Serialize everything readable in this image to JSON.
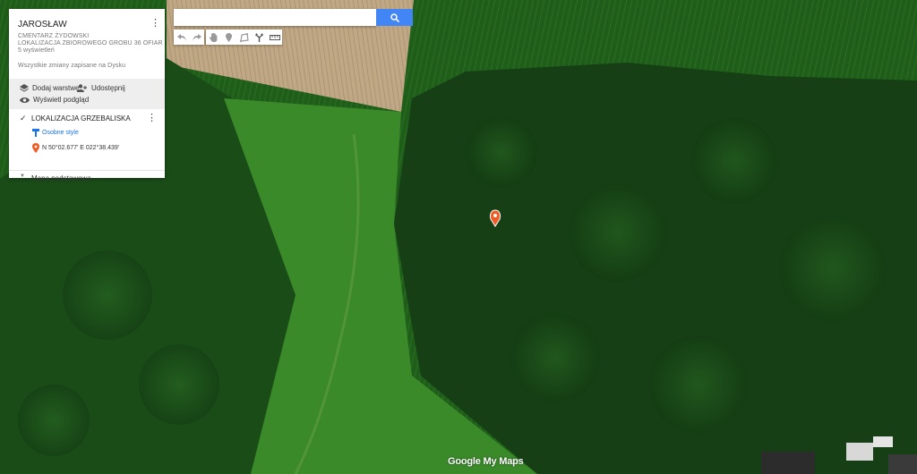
{
  "map": {
    "colors": {
      "field": "#1c5a17",
      "harvested": "#b39a78",
      "meadow": "#3f8a2c",
      "forest": "#153d14"
    },
    "marker_color": "#f05a24"
  },
  "sidebar": {
    "title": "JAROSŁAW",
    "subtitle_line1": "CMENTARZ ŻYDOWSKI",
    "subtitle_line2": "LOKALIZACJA ZBIOROWEGO GROBU 36 OFIAR",
    "views": "5 wyświetleń",
    "saved_status": "Wszystkie zmiany zapisane na Dysku",
    "add_layer": "Dodaj warstwę",
    "share": "Udostępnij",
    "preview": "Wyświetl podgląd",
    "layer": {
      "name": "LOKALIZACJA GRZEBALISKA",
      "style_link": "Osobne style",
      "point": "N 50°02.677' E 022°38.439'"
    },
    "base_map": "Mapa podstawowa"
  },
  "search": {
    "placeholder": "",
    "value": ""
  },
  "toolbar": {
    "icons": [
      "undo-icon",
      "redo-icon",
      "hand-icon",
      "marker-icon",
      "polygon-icon",
      "route-icon",
      "ruler-icon"
    ]
  },
  "branding": {
    "logo": "Google My Maps"
  }
}
